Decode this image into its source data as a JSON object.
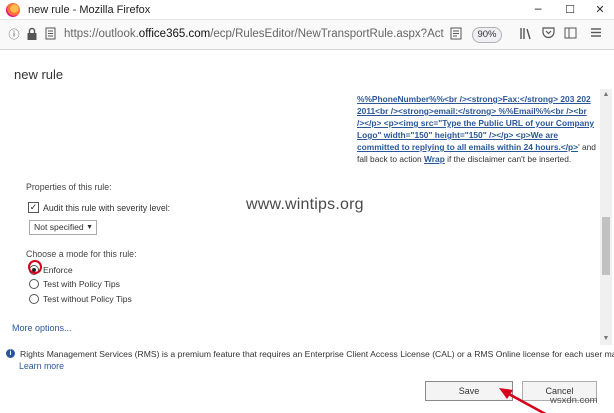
{
  "window": {
    "title": "new rule - Mozilla Firefox",
    "minimize": "─",
    "maximize": "☐",
    "close": "✕"
  },
  "navbar": {
    "url_prefix": "https://outlook.",
    "url_domain": "office365.com",
    "url_path": "/ecp/RulesEditor/NewTransportRule.aspx?ActivityCorr",
    "zoom": "90%",
    "icons": [
      "info-icon",
      "lock-icon",
      "page-icon",
      "reader-view-icon",
      "library-icon",
      "pocket-icon",
      "sidebar-icon",
      "menu-icon"
    ]
  },
  "page": {
    "title": "new rule",
    "disclaimer_lines": [
      "%%PhoneNumber%%<br /><strong>Fax:</strong> 203 202",
      "2011<br /><strong>email:</strong> %%Email%%<br /><br",
      "/></p> <p><img src=\"Type the Public URL of your Company",
      "Logo\" width=\"150\" height=\"150\" /></p> <p>We are",
      "committed to replying to all emails within 24 hours.</p>"
    ],
    "disclaimer_suffix": "' and",
    "disclaimer_fallback_prefix": "fall back to action ",
    "disclaimer_fallback_link": "Wrap",
    "disclaimer_fallback_suffix": " if the disclaimer can't be inserted.",
    "properties_label": "Properties of this rule:",
    "audit_label": "Audit this rule with severity level:",
    "audit_checked": true,
    "severity_value": "Not specified",
    "mode_label": "Choose a mode for this rule:",
    "modes": [
      {
        "label": "Enforce",
        "checked": true
      },
      {
        "label": "Test with Policy Tips",
        "checked": false
      },
      {
        "label": "Test without Policy Tips",
        "checked": false
      }
    ],
    "more_options": "More options...",
    "rms_notice": "Rights Management Services (RMS) is a premium feature that requires an Enterprise Client Access License (CAL) or a RMS Online license for each user mailbox.",
    "learn_more": "Learn more",
    "save_label": "Save",
    "cancel_label": "Cancel"
  },
  "watermark": "www.wintips.org",
  "watermark_sub": "wsxdn.com",
  "colors": {
    "link": "#2b579a",
    "highlight": "#d6001c"
  }
}
